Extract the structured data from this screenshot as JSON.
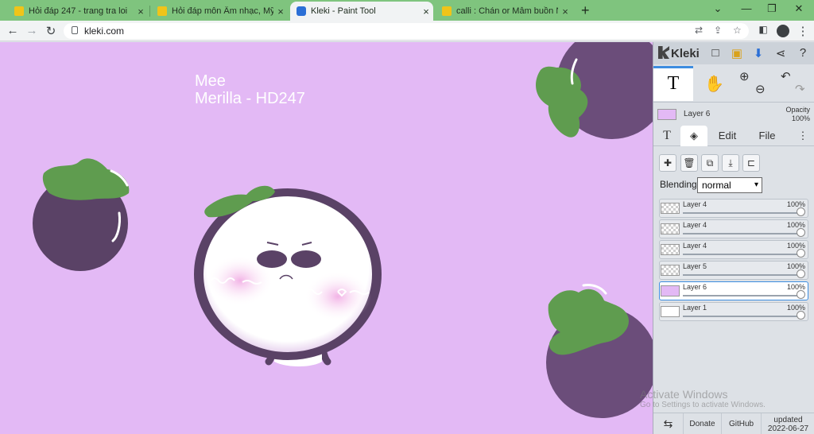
{
  "browser": {
    "tabs": [
      {
        "title": "Hỏi đáp 247 - trang tra loi",
        "close": "×"
      },
      {
        "title": "Hỏi đáp môn Âm nhạc, Mỹ thuật",
        "close": "×"
      },
      {
        "title": "Kleki - Paint Tool",
        "close": "×"
      },
      {
        "title": "calli : Chán or Mẫm buồn NL : ba",
        "close": "×"
      }
    ],
    "new_tab": "+",
    "url": "kleki.com",
    "window_controls": [
      "⌄",
      "—",
      "❐",
      "✕"
    ]
  },
  "canvas": {
    "text_line1": "Mee",
    "text_line2": "Merilla - HD247",
    "colors": {
      "background": "#e3b9f5",
      "fruit": "#5a4266",
      "leaf": "#5f9c4f"
    }
  },
  "panel": {
    "brand": "Kleki",
    "current_layer": {
      "name": "Layer 6",
      "opacity_label": "Opacity",
      "opacity_value": "100%"
    },
    "tabs": {
      "text_tool": "T",
      "edit": "Edit",
      "file": "File",
      "more": "⋮"
    },
    "blending_label": "Blending",
    "blending_value": "normal",
    "layers": [
      {
        "name": "Layer 4",
        "opacity": "100%"
      },
      {
        "name": "Layer 4",
        "opacity": "100%"
      },
      {
        "name": "Layer 4",
        "opacity": "100%"
      },
      {
        "name": "Layer 5",
        "opacity": "100%"
      },
      {
        "name": "Layer 6",
        "opacity": "100%"
      },
      {
        "name": "Layer 1",
        "opacity": "100%"
      }
    ],
    "footer": {
      "swap": "⇆",
      "donate": "Donate",
      "github": "GitHub",
      "updated_label": "updated",
      "updated_date": "2022-06-27"
    }
  },
  "watermark": {
    "line1": "Activate Windows",
    "line2": "Go to Settings to activate Windows."
  }
}
